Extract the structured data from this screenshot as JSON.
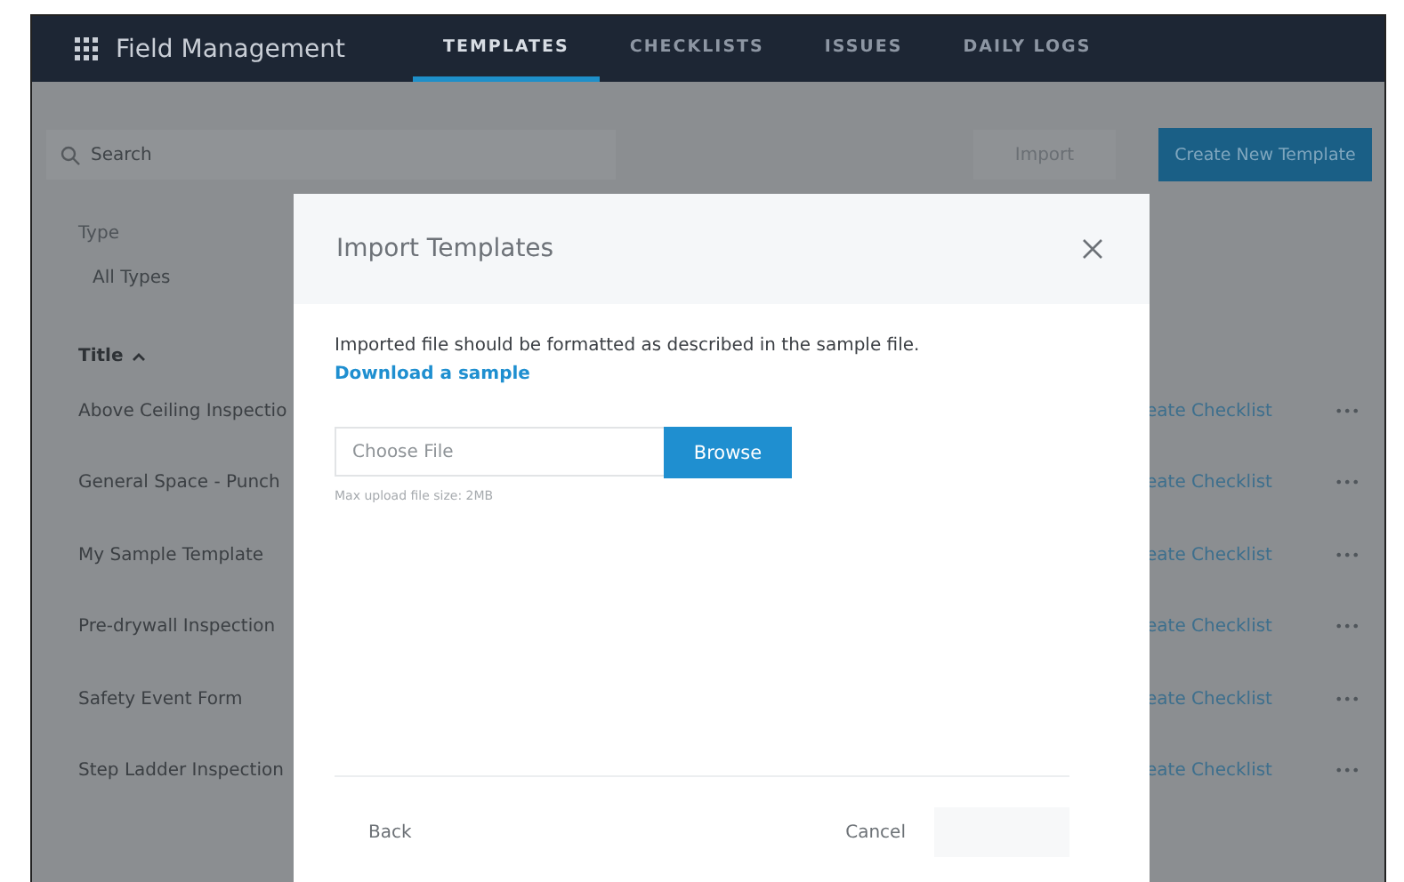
{
  "header": {
    "app_title": "Field Management",
    "tabs": [
      {
        "label": "TEMPLATES",
        "selected": true
      },
      {
        "label": "CHECKLISTS",
        "selected": false
      },
      {
        "label": "ISSUES",
        "selected": false
      },
      {
        "label": "DAILY LOGS",
        "selected": false
      }
    ]
  },
  "toolbar": {
    "search": {
      "placeholder": "Search"
    },
    "import_button": "Import",
    "create_button": "Create New Template"
  },
  "filter": {
    "label": "Type",
    "value": "All Types"
  },
  "table": {
    "sort_column": "Title",
    "sort_ascending": true,
    "rows": [
      {
        "title": "Above Ceiling Inspectio",
        "action": "eate Checklist",
        "more": "•••"
      },
      {
        "title": "General Space - Punch",
        "action": "eate Checklist",
        "more": "•••"
      },
      {
        "title": "My Sample Template",
        "action": "eate Checklist",
        "more": "•••"
      },
      {
        "title": "Pre-drywall Inspection",
        "action": "eate Checklist",
        "more": "•••"
      },
      {
        "title": "Safety Event Form",
        "action": "eate Checklist",
        "more": "•••"
      },
      {
        "title": "Step Ladder Inspection",
        "action": "eate Checklist",
        "more": "•••"
      }
    ]
  },
  "dialog": {
    "title": "Import Templates",
    "message": "Imported file should be formatted as described in the sample file.",
    "link": "Download a sample",
    "file_field": {
      "placeholder": "Choose File"
    },
    "browse_button": "Browse",
    "hint": "Max upload file size: 2MB",
    "back_button": "Back",
    "cancel_button": "Cancel",
    "submit_disabled": true
  }
}
